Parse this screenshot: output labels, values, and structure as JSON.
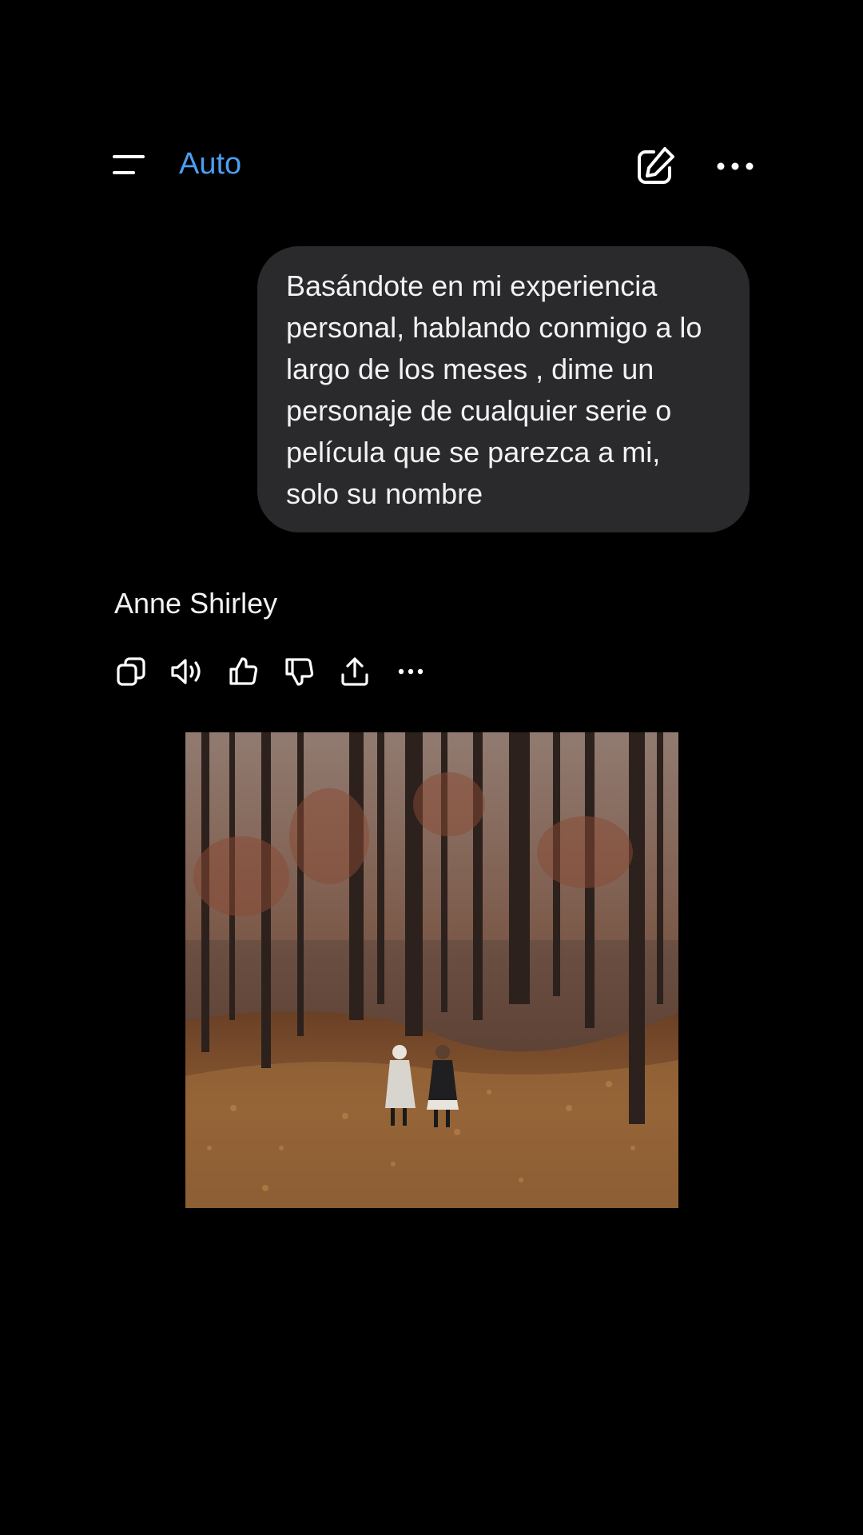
{
  "header": {
    "model_label": "Auto",
    "menu_icon": "menu-lines-icon",
    "edit_icon": "new-chat-edit-icon",
    "more_icon": "more-horizontal-icon"
  },
  "conversation": {
    "user_message": "Basándote en mi experiencia personal, hablando conmigo a lo largo de los meses , dime un personaje de cualquier serie o película que se parezca a mi, solo su nombre",
    "assistant_message": "Anne Shirley",
    "actions": [
      "copy-icon",
      "read-aloud-icon",
      "thumbs-up-icon",
      "thumbs-down-icon",
      "share-icon",
      "more-horizontal-icon"
    ]
  },
  "photo": {
    "subject": "two girls walking hand in hand through an autumn forest covered in fallen leaves"
  },
  "colors": {
    "background": "#000000",
    "accent": "#4a9ff0",
    "bubble": "#2a2a2c",
    "text": "#f2f2f2"
  }
}
